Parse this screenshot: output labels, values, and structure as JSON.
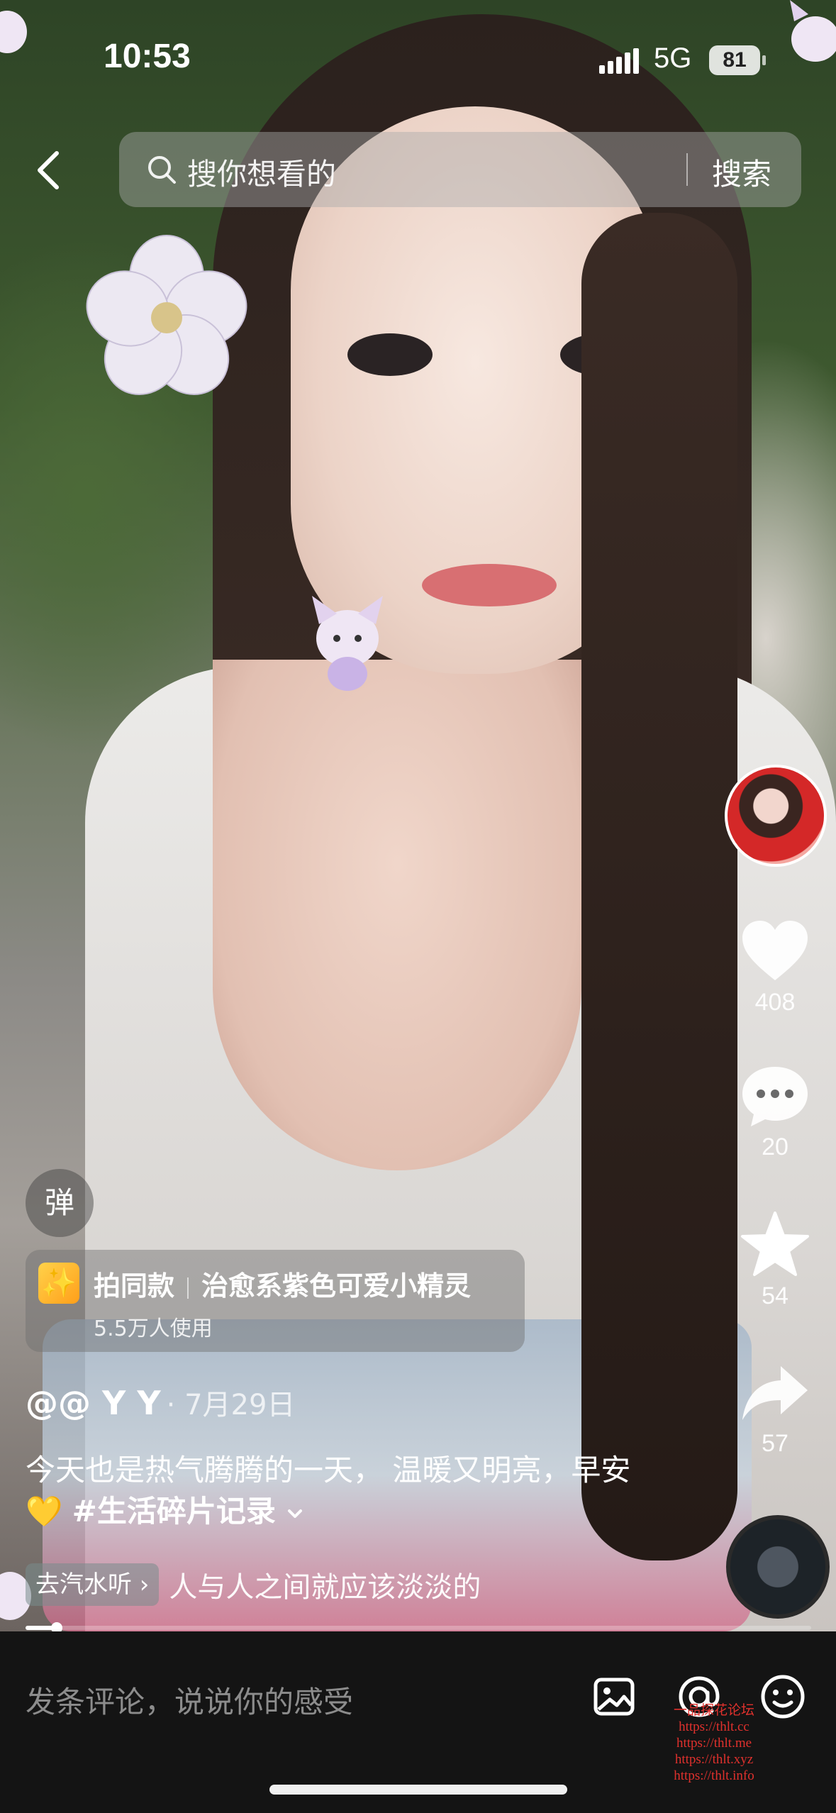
{
  "status_bar": {
    "time": "10:53",
    "network": "5G",
    "battery": "81"
  },
  "search": {
    "placeholder": "搜你想看的",
    "button": "搜索"
  },
  "rail": {
    "likes": "408",
    "comments": "20",
    "favorites": "54",
    "shares": "57"
  },
  "danmu_label": "弹",
  "effect": {
    "label": "拍同款",
    "name": "治愈系紫色可爱小精灵",
    "uses": "5.5万人使用",
    "icon": "✨"
  },
  "post": {
    "author": "@@ Y Y",
    "date": "· 7月29日",
    "caption": "今天也是热气腾腾的一天， 温暖又明亮，早安💛",
    "hashtag": "#生活碎片记录",
    "expand_icon": "chevron-down-icon"
  },
  "music": {
    "chip": "去汽水听 ›",
    "title": "人与人之间就应该淡淡的"
  },
  "progress": 0.04,
  "comment_bar": {
    "placeholder": "发条评论，说说你的感受"
  },
  "watermark": [
    "一品探花论坛",
    "https://thlt.cc",
    "https://thlt.me",
    "https://thlt.xyz",
    "https://thlt.info"
  ]
}
